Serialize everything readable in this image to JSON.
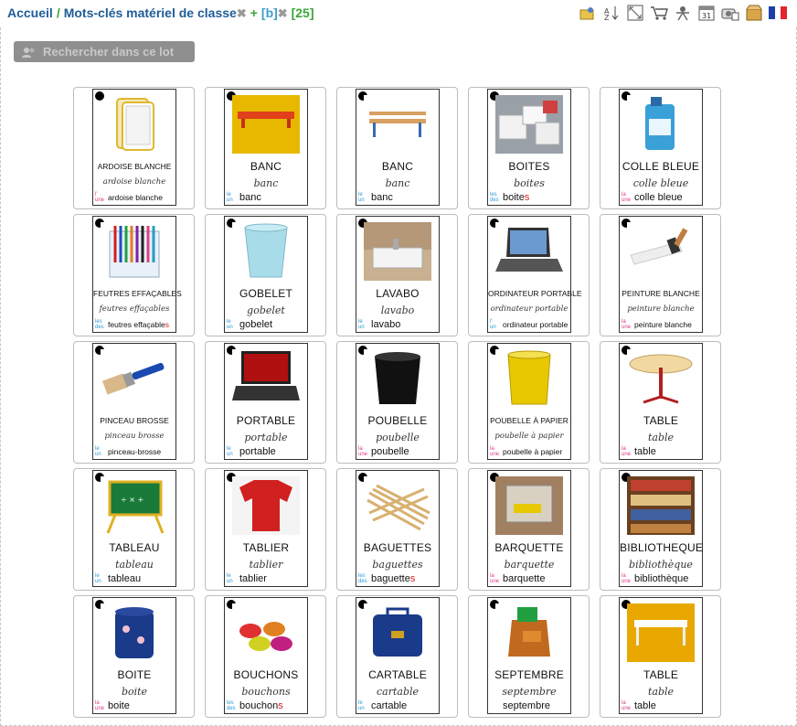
{
  "breadcrumb": {
    "home": "Accueil",
    "separator": "/",
    "category": "Mots-clés matériel de classe",
    "remove_icon": "x",
    "plus": "+",
    "filter": "[b]",
    "count": "[25]"
  },
  "toolbar_icons": [
    "folder-user-icon",
    "sort-az-icon",
    "fullscreen-icon",
    "cart-icon",
    "presenter-icon",
    "calendar-31-icon",
    "photo-calendar-icon",
    "box-icon",
    "french-flag-icon"
  ],
  "search_button": {
    "label": "Rechercher dans ce lot",
    "icon": "users-icon"
  },
  "cards": [
    {
      "caption": "ARDOISE BLANCHE",
      "script": "ardoise blanche",
      "article": [
        "l'",
        "une"
      ],
      "word": "ardoise blanche",
      "small": true,
      "plural": false,
      "pic": "ardoise"
    },
    {
      "caption": "BANC",
      "script": "banc",
      "article": [
        "le",
        "un"
      ],
      "word": "banc",
      "small": false,
      "plural": false,
      "pic": "banc-red"
    },
    {
      "caption": "BANC",
      "script": "banc",
      "article": [
        "le",
        "un"
      ],
      "word": "banc",
      "small": false,
      "plural": false,
      "pic": "banc"
    },
    {
      "caption": "BOITES",
      "script": "boites",
      "article": [
        "les",
        "des"
      ],
      "word": "boites",
      "small": false,
      "plural": true,
      "pic": "boites"
    },
    {
      "caption": "COLLE BLEUE",
      "script": "colle bleue",
      "article": [
        "la",
        "une"
      ],
      "word": "colle bleue",
      "small": false,
      "plural": false,
      "pic": "colle"
    },
    {
      "caption": "FEUTRES EFFAÇABLES",
      "script": "feutres effaçables",
      "article": [
        "les",
        "des"
      ],
      "word": "feutres effaçables",
      "small": true,
      "plural": true,
      "pic": "feutres"
    },
    {
      "caption": "GOBELET",
      "script": "gobelet",
      "article": [
        "le",
        "un"
      ],
      "word": "gobelet",
      "small": false,
      "plural": false,
      "pic": "gobelet"
    },
    {
      "caption": "LAVABO",
      "script": "lavabo",
      "article": [
        "le",
        "un"
      ],
      "word": "lavabo",
      "small": false,
      "plural": false,
      "pic": "lavabo"
    },
    {
      "caption": "ORDINATEUR PORTABLE",
      "script": "ordinateur portable",
      "article": [
        "l'",
        "un"
      ],
      "word": "ordinateur portable",
      "small": true,
      "plural": false,
      "pic": "laptop"
    },
    {
      "caption": "PEINTURE BLANCHE",
      "script": "peinture blanche",
      "article": [
        "la",
        "une"
      ],
      "word": "peinture blanche",
      "small": true,
      "plural": false,
      "pic": "peinture"
    },
    {
      "caption": "PINCEAU BROSSE",
      "script": "pinceau brosse",
      "article": [
        "le",
        "un"
      ],
      "word": "pinceau-brosse",
      "small": true,
      "plural": false,
      "pic": "pinceau"
    },
    {
      "caption": "PORTABLE",
      "script": "portable",
      "article": [
        "le",
        "un"
      ],
      "word": "portable",
      "small": false,
      "plural": false,
      "pic": "laptop2"
    },
    {
      "caption": "POUBELLE",
      "script": "poubelle",
      "article": [
        "la",
        "une"
      ],
      "word": "poubelle",
      "small": false,
      "plural": false,
      "pic": "poubelle"
    },
    {
      "caption": "POUBELLE À PAPIER",
      "script": "poubelle à papier",
      "article": [
        "la",
        "une"
      ],
      "word": "poubelle à papier",
      "small": true,
      "plural": false,
      "pic": "poubelle-jaune"
    },
    {
      "caption": "TABLE",
      "script": "table",
      "article": [
        "la",
        "une"
      ],
      "word": "table",
      "small": false,
      "plural": false,
      "pic": "table-ronde"
    },
    {
      "caption": "TABLEAU",
      "script": "tableau",
      "article": [
        "le",
        "un"
      ],
      "word": "tableau",
      "small": false,
      "plural": false,
      "pic": "tableau"
    },
    {
      "caption": "TABLIER",
      "script": "tablier",
      "article": [
        "le",
        "un"
      ],
      "word": "tablier",
      "small": false,
      "plural": false,
      "pic": "tablier"
    },
    {
      "caption": "BAGUETTES",
      "script": "baguettes",
      "article": [
        "les",
        "des"
      ],
      "word": "baguettes",
      "small": false,
      "plural": true,
      "pic": "baguettes"
    },
    {
      "caption": "BARQUETTE",
      "script": "barquette",
      "article": [
        "la",
        "une"
      ],
      "word": "barquette",
      "small": false,
      "plural": false,
      "pic": "barquette"
    },
    {
      "caption": "BIBLIOTHEQUE",
      "script": "bibliothèque",
      "article": [
        "la",
        "une"
      ],
      "word": "bibliothèque",
      "small": false,
      "plural": false,
      "pic": "biblio"
    },
    {
      "caption": "BOITE",
      "script": "boite",
      "article": [
        "la",
        "une"
      ],
      "word": "boite",
      "small": false,
      "plural": false,
      "pic": "boite"
    },
    {
      "caption": "BOUCHONS",
      "script": "bouchons",
      "article": [
        "les",
        "des"
      ],
      "word": "bouchons",
      "small": false,
      "plural": true,
      "pic": "bouchons"
    },
    {
      "caption": "CARTABLE",
      "script": "cartable",
      "article": [
        "le",
        "un"
      ],
      "word": "cartable",
      "small": false,
      "plural": false,
      "pic": "cartable"
    },
    {
      "caption": "SEPTEMBRE",
      "script": "septembre",
      "article": [
        "",
        ""
      ],
      "word": "septembre",
      "small": false,
      "plural": false,
      "pic": "septembre"
    },
    {
      "caption": "TABLE",
      "script": "table",
      "article": [
        "la",
        "une"
      ],
      "word": "table",
      "small": false,
      "plural": false,
      "pic": "table"
    }
  ]
}
